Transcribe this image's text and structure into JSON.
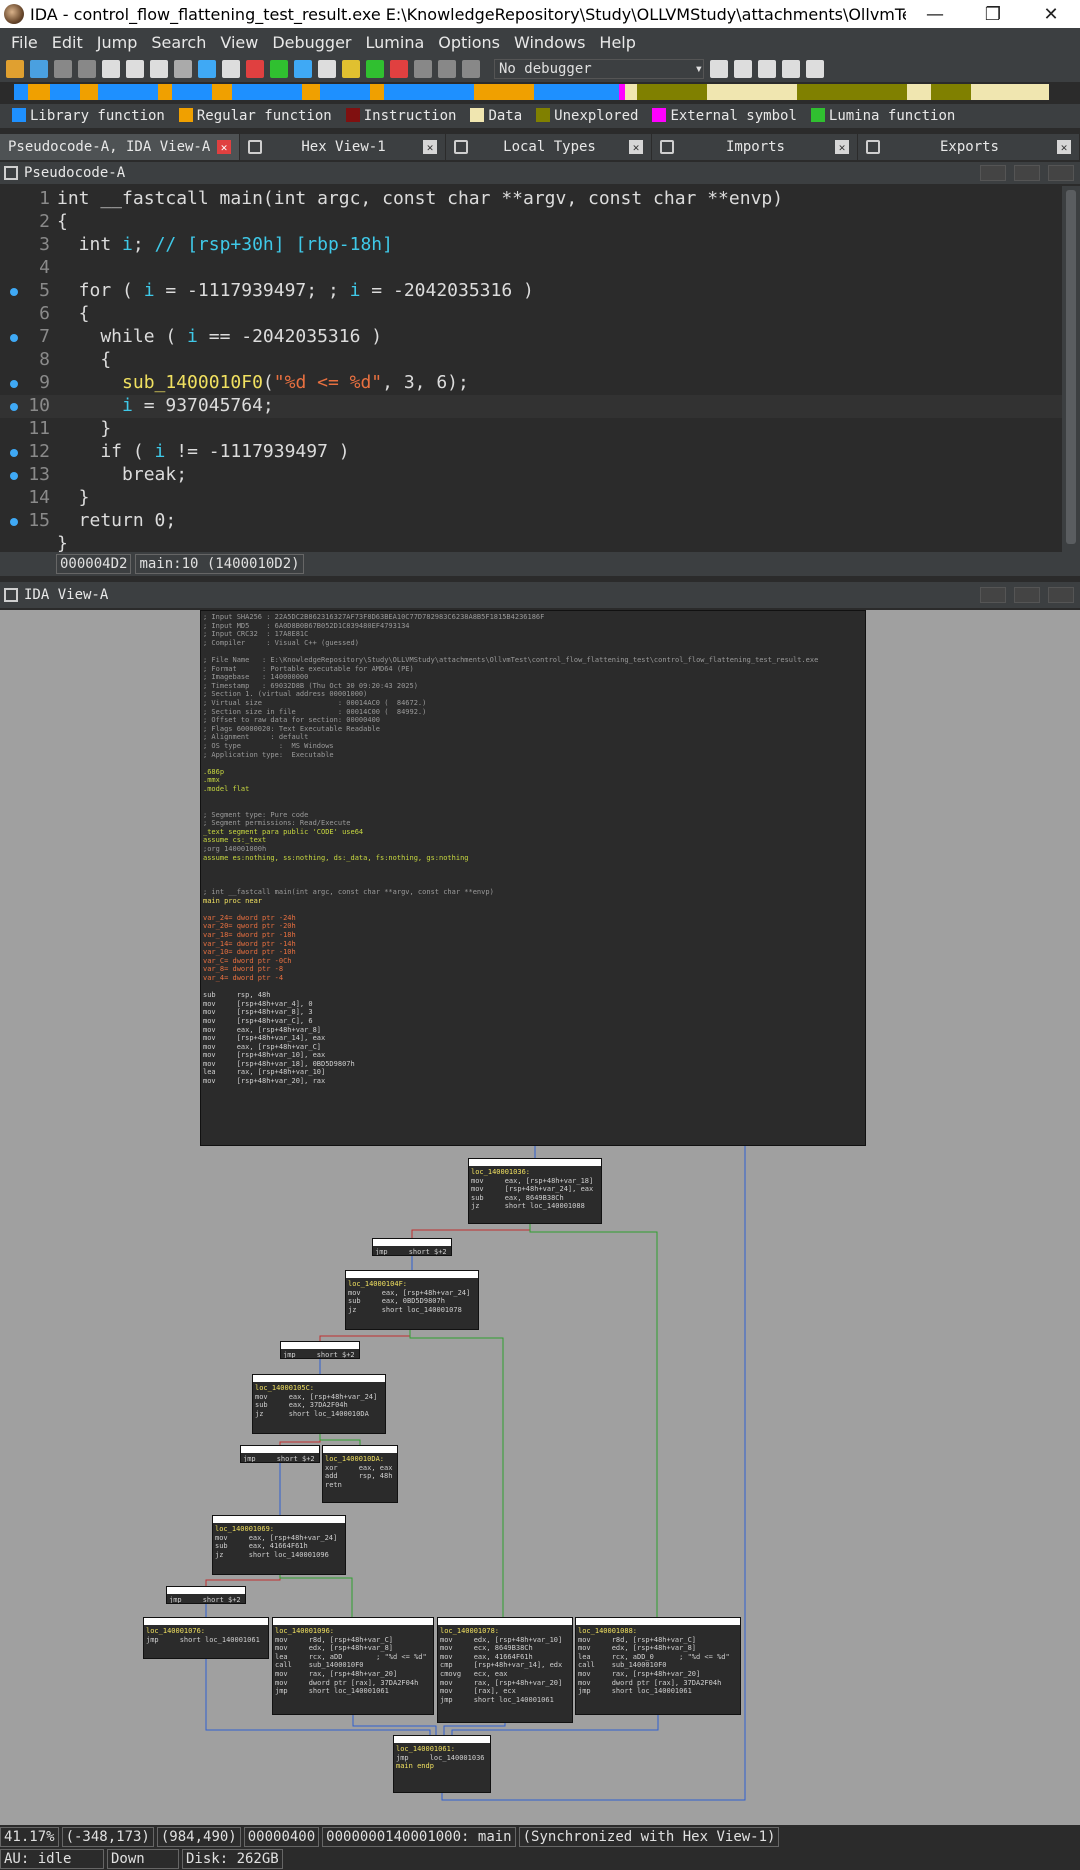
{
  "window": {
    "title": "IDA - control_flow_flattening_test_result.exe E:\\KnowledgeRepository\\Study\\OLLVMStudy\\attachments\\OllvmTest\\co...",
    "minimize": "—",
    "maximize": "❐",
    "close": "✕"
  },
  "menu": [
    "File",
    "Edit",
    "Jump",
    "Search",
    "View",
    "Debugger",
    "Lumina",
    "Options",
    "Windows",
    "Help"
  ],
  "toolbar": {
    "debugger_select": "No debugger"
  },
  "legend": [
    {
      "label": "Library function",
      "color": "#1e90ff"
    },
    {
      "label": "Regular function",
      "color": "#f0a000"
    },
    {
      "label": "Instruction",
      "color": "#801010"
    },
    {
      "label": "Data",
      "color": "#f0e6b0"
    },
    {
      "label": "Unexplored",
      "color": "#808000"
    },
    {
      "label": "External symbol",
      "color": "#ff00ff"
    },
    {
      "label": "Lumina function",
      "color": "#30c030"
    }
  ],
  "tabs": [
    {
      "label": "Pseudocode-A, IDA View-A"
    },
    {
      "label": "Hex View-1"
    },
    {
      "label": "Local Types"
    },
    {
      "label": "Imports"
    },
    {
      "label": "Exports"
    }
  ],
  "pseudocode": {
    "panel_title": "Pseudocode-A",
    "lines": [
      {
        "n": "1",
        "t": "int __fastcall main(int argc, const char **argv, const char **envp)"
      },
      {
        "n": "2",
        "t": "{"
      },
      {
        "n": "3",
        "t": "  int i; // [rsp+30h] [rbp-18h]"
      },
      {
        "n": "4",
        "t": ""
      },
      {
        "n": "5",
        "t": "  for ( i = -1117939497; ; i = -2042035316 )"
      },
      {
        "n": "6",
        "t": "  {"
      },
      {
        "n": "7",
        "t": "    while ( i == -2042035316 )"
      },
      {
        "n": "8",
        "t": "    {"
      },
      {
        "n": "9",
        "t": "      sub_1400010F0(\"%d <= %d\", 3, 6);"
      },
      {
        "n": "10",
        "t": "      i = 937045764;"
      },
      {
        "n": "11",
        "t": "    }"
      },
      {
        "n": "12",
        "t": "    if ( i != -1117939497 )"
      },
      {
        "n": "13",
        "t": "      break;"
      },
      {
        "n": "14",
        "t": "  }"
      },
      {
        "n": "15",
        "t": "  return 0;"
      },
      {
        "n": "",
        "t": "}"
      }
    ],
    "status": [
      "000004D2",
      "main:10 (1400010D2)"
    ]
  },
  "idaview": {
    "panel_title": "IDA View-A",
    "header_lines": [
      "; Input SHA256 : 22A5DC2B862316327AF73F8D63BEA10C77D782983C6238A8B5F1815B4236186F",
      "; Input MD5    : 6A0D8B0B67B052D1C839480EF4793134",
      "; Input CRC32  : 17A8E81C",
      "; Compiler     : Visual C++ (guessed)",
      "",
      "; File Name   : E:\\KnowledgeRepository\\Study\\OLLVMStudy\\attachments\\OllvmTest\\control_flow_flattening_test\\control_flow_flattening_test_result.exe",
      "; Format      : Portable executable for AMD64 (PE)",
      "; Imagebase   : 140000000",
      "; Timestamp   : 69032D8B (Thu Oct 30 09:20:43 2025)",
      "; Section 1. (virtual address 00001000)",
      "; Virtual size                  : 00014AC0 (  84672.)",
      "; Section size in file          : 00014C00 (  84992.)",
      "; Offset to raw data for section: 00000400",
      "; Flags 60000020: Text Executable Readable",
      "; Alignment     : default",
      "; OS type         :  MS Windows",
      "; Application type:  Executable",
      "",
      ".686p",
      ".mmx",
      ".model flat",
      "",
      "",
      "; Segment type: Pure code",
      "; Segment permissions: Read/Execute",
      "_text segment para public 'CODE' use64",
      "assume cs:_text",
      ";org 140001000h",
      "assume es:nothing, ss:nothing, ds:_data, fs:nothing, gs:nothing",
      "",
      "",
      "",
      "; int __fastcall main(int argc, const char **argv, const char **envp)",
      "main proc near",
      "",
      "var_24= dword ptr -24h",
      "var_20= qword ptr -20h",
      "var_18= dword ptr -18h",
      "var_14= dword ptr -14h",
      "var_10= dword ptr -10h",
      "var_C= dword ptr -0Ch",
      "var_8= dword ptr -8",
      "var_4= dword ptr -4",
      "",
      "sub     rsp, 48h",
      "mov     [rsp+48h+var_4], 0",
      "mov     [rsp+48h+var_8], 3",
      "mov     [rsp+48h+var_C], 6",
      "mov     eax, [rsp+48h+var_8]",
      "mov     [rsp+48h+var_14], eax",
      "mov     eax, [rsp+48h+var_C]",
      "mov     [rsp+48h+var_10], eax",
      "mov     [rsp+48h+var_18], 0BD5D9807h",
      "lea     rax, [rsp+48h+var_10]",
      "mov     [rsp+48h+var_20], rax"
    ],
    "blocks": [
      {
        "id": "b1036",
        "lines": [
          "loc_140001036:",
          "mov     eax, [rsp+48h+var_18]",
          "mov     [rsp+48h+var_24], eax",
          "sub     eax, 8649B38Ch",
          "jz      short loc_140001088"
        ]
      },
      {
        "id": "bj1",
        "lines": [
          "jmp     short $+2"
        ]
      },
      {
        "id": "b104f",
        "lines": [
          "loc_14000104F:",
          "mov     eax, [rsp+48h+var_24]",
          "sub     eax, 0BD5D9807h",
          "jz      short loc_140001078"
        ]
      },
      {
        "id": "bj2",
        "lines": [
          "jmp     short $+2"
        ]
      },
      {
        "id": "b105c",
        "lines": [
          "loc_14000105C:",
          "mov     eax, [rsp+48h+var_24]",
          "sub     eax, 37DA2F04h",
          "jz      short loc_1400010DA"
        ]
      },
      {
        "id": "bj3",
        "lines": [
          "jmp     short $+2"
        ]
      },
      {
        "id": "b10da",
        "lines": [
          "loc_1400010DA:",
          "xor     eax, eax",
          "add     rsp, 48h",
          "retn"
        ]
      },
      {
        "id": "b1069",
        "lines": [
          "loc_140001069:",
          "mov     eax, [rsp+48h+var_24]",
          "sub     eax, 41664F61h",
          "jz      short loc_140001096"
        ]
      },
      {
        "id": "bj4",
        "lines": [
          "jmp     short $+2"
        ]
      },
      {
        "id": "b1076",
        "lines": [
          "loc_140001076:",
          "jmp     short loc_140001061"
        ]
      },
      {
        "id": "b1096",
        "lines": [
          "loc_140001096:",
          "mov     r8d, [rsp+48h+var_C]",
          "mov     edx, [rsp+48h+var_8]",
          "lea     rcx, aDD        ; \"%d <= %d\"",
          "call    sub_1400010F0",
          "mov     rax, [rsp+48h+var_20]",
          "mov     dword ptr [rax], 37DA2F04h",
          "jmp     short loc_140001061"
        ]
      },
      {
        "id": "b1078",
        "lines": [
          "loc_140001078:",
          "mov     edx, [rsp+48h+var_10]",
          "mov     ecx, 8649B38Ch",
          "mov     eax, 41664F61h",
          "cmp     [rsp+48h+var_14], edx",
          "cmovg   ecx, eax",
          "mov     rax, [rsp+48h+var_20]",
          "mov     [rax], ecx",
          "jmp     short loc_140001061"
        ]
      },
      {
        "id": "b1088",
        "lines": [
          "loc_140001088:",
          "mov     r8d, [rsp+48h+var_C]",
          "mov     edx, [rsp+48h+var_8]",
          "lea     rcx, aDD_0      ; \"%d <= %d\"",
          "call    sub_1400010F0",
          "mov     rax, [rsp+48h+var_20]",
          "mov     dword ptr [rax], 37DA2F04h",
          "jmp     short loc_140001061"
        ]
      },
      {
        "id": "b1061",
        "lines": [
          "loc_140001061:",
          "jmp     loc_140001036",
          "main endp"
        ]
      }
    ]
  },
  "status_bar": {
    "zoom": "41.17%",
    "coords1": "(-348,173)",
    "coords2": "(984,490)",
    "offset": "00000400",
    "address": "0000000140001000: main",
    "sync": "(Synchronized with Hex View-1)",
    "au": "AU:  idle",
    "dir": "Down",
    "disk": "Disk: 262GB"
  }
}
